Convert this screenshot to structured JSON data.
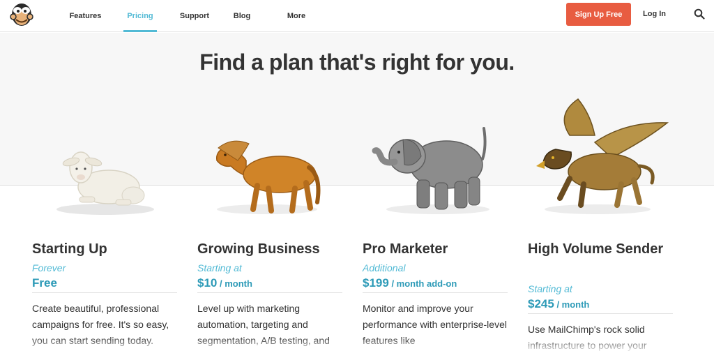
{
  "header": {
    "logo_icon": "freddie-chimp-logo",
    "nav": [
      "Features",
      "Pricing",
      "Support",
      "Blog",
      "More"
    ],
    "active_nav": "Pricing",
    "signup_label": "Sign Up Free",
    "login_label": "Log In",
    "search_icon": "search-icon",
    "accent_color": "#52bad5",
    "cta_color": "#e85c41"
  },
  "hero": {
    "title": "Find a plan that's right for you."
  },
  "plans": [
    {
      "name": "Starting Up",
      "sub": "Forever",
      "price": "Free",
      "unit": "",
      "desc": "Create beautiful, professional campaigns for free. It's so easy, you can start sending today.",
      "image": "lamb-figurine"
    },
    {
      "name": "Growing Business",
      "sub": "Starting at",
      "price": "$10",
      "unit": " / month",
      "desc": "Level up with marketing automation, targeting and segmentation, A/B testing, and",
      "image": "horse-figurine"
    },
    {
      "name": "Pro Marketer",
      "sub": "Additional",
      "price": "$199",
      "unit": " / month add-on",
      "desc": "Monitor and improve your performance with enterprise-level features like",
      "image": "elephant-figurine"
    },
    {
      "name": "High Volume Sender",
      "sub": "Starting at",
      "price": "$245",
      "unit": " / month",
      "desc": "Use MailChimp's rock solid infrastructure to power your",
      "image": "griffin-figurine"
    }
  ]
}
